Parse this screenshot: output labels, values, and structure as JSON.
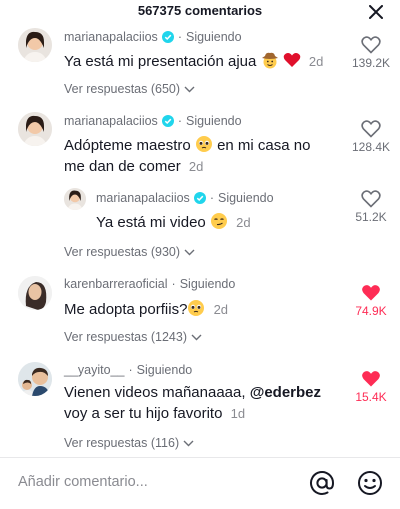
{
  "header": {
    "title": "567375 comentarios"
  },
  "comments": [
    {
      "username": "marianapalaciios",
      "following": "Siguiendo",
      "text": "Ya está mi presentación ajua",
      "date": "2d",
      "replies_label": "Ver respuestas (650)",
      "likes": "139.2K",
      "liked": false
    },
    {
      "username": "marianapalaciios",
      "following": "Siguiendo",
      "text_line1": "Adópteme maestro",
      "text_line1b": "en mi casa no",
      "text_line2": "me dan de comer",
      "date": "2d",
      "likes": "128.4K",
      "liked": false,
      "reply": {
        "username": "marianapalaciios",
        "following": "Siguiendo",
        "text": "Ya está mi video",
        "date": "2d",
        "likes": "51.2K",
        "liked": false
      },
      "replies_label": "Ver respuestas (930)"
    },
    {
      "username": "karenbarreraoficial",
      "following": "Siguiendo",
      "text": "Me adopta porfiis?",
      "date": "2d",
      "replies_label": "Ver respuestas (1243)",
      "likes": "74.9K",
      "liked": true
    },
    {
      "username": "__yayito__",
      "following": "Siguiendo",
      "text_line1": "Vienen videos mañanaaaa,",
      "mention": "@ederbez",
      "text_line2": "voy a ser tu hijo favorito",
      "date": "1d",
      "replies_label": "Ver respuestas (116)",
      "likes": "15.4K",
      "liked": true
    }
  ],
  "input": {
    "placeholder": "Añadir comentario..."
  },
  "icons": {
    "close": "close-icon",
    "verified": "verified-badge-icon",
    "heart": "heart-icon",
    "chevron": "chevron-down-icon",
    "at": "at-sign-icon",
    "emoji": "emoji-icon"
  },
  "colors": {
    "liked": "#fe2c55",
    "verified": "#20d5ec",
    "muted": "#6b6e76"
  }
}
